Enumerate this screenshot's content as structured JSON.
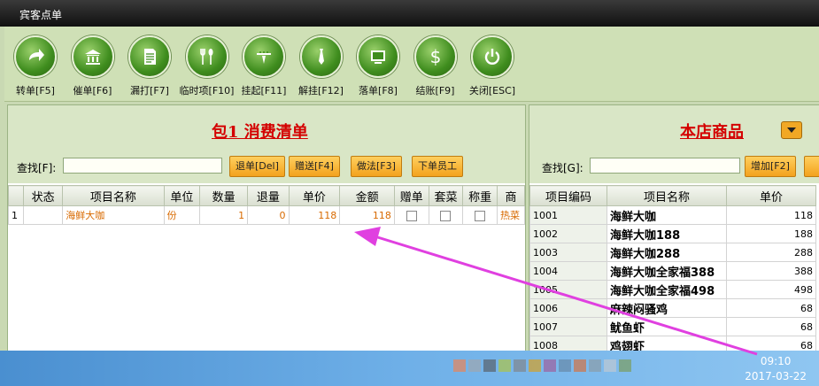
{
  "window": {
    "title": "宾客点单"
  },
  "toolbar": [
    {
      "label": "转单[F5]",
      "icon": "arrow-right-icon"
    },
    {
      "label": "催单[F6]",
      "icon": "bank-icon"
    },
    {
      "label": "漏打[F7]",
      "icon": "document-icon"
    },
    {
      "label": "临时项[F10]",
      "icon": "utensils-icon"
    },
    {
      "label": "挂起[F11]",
      "icon": "waiter-icon"
    },
    {
      "label": "解挂[F12]",
      "icon": "tie-icon"
    },
    {
      "label": "落单[F8]",
      "icon": "monitor-icon"
    },
    {
      "label": "结账[F9]",
      "icon": "dollar-icon"
    },
    {
      "label": "关闭[ESC]",
      "icon": "power-icon"
    }
  ],
  "left": {
    "title": "包1  消费清单",
    "search_label": "查找[F]:",
    "search_value": "",
    "buttons": [
      "退单[Del]",
      "赠送[F4]",
      "做法[F3]",
      "下单员工"
    ],
    "columns": [
      "",
      "状态",
      "项目名称",
      "单位",
      "数量",
      "退量",
      "单价",
      "金额",
      "赠单",
      "套菜",
      "称重",
      "商"
    ],
    "rows": [
      {
        "idx": "1",
        "status": "",
        "name": "海鲜大咖",
        "unit": "份",
        "qty": "1",
        "ret": "0",
        "price": "118",
        "amount": "118",
        "cat": "热菜"
      }
    ]
  },
  "right": {
    "title": "本店商品",
    "search_label": "查找[G]:",
    "search_value": "",
    "add_button": "增加[F2]",
    "columns": [
      "项目编码",
      "项目名称",
      "单价"
    ],
    "rows": [
      {
        "code": "1001",
        "name": "海鲜大咖",
        "price": "118"
      },
      {
        "code": "1002",
        "name": "海鲜大咖188",
        "price": "188"
      },
      {
        "code": "1003",
        "name": "海鲜大咖288",
        "price": "288"
      },
      {
        "code": "1004",
        "name": "海鲜大咖全家福388",
        "price": "388"
      },
      {
        "code": "1005",
        "name": "海鲜大咖全家福498",
        "price": "498"
      },
      {
        "code": "1006",
        "name": "麻辣闷骚鸡",
        "price": "68"
      },
      {
        "code": "1007",
        "name": "鱿鱼虾",
        "price": "68"
      },
      {
        "code": "1008",
        "name": "鸡翅虾",
        "price": "68"
      }
    ]
  },
  "taskbar": {
    "time": "09:10",
    "date": "2017-03-22"
  },
  "colors": {
    "accent_red": "#d40000",
    "orange": "#f3a21d",
    "annotation_arrow": "#e040e0"
  }
}
